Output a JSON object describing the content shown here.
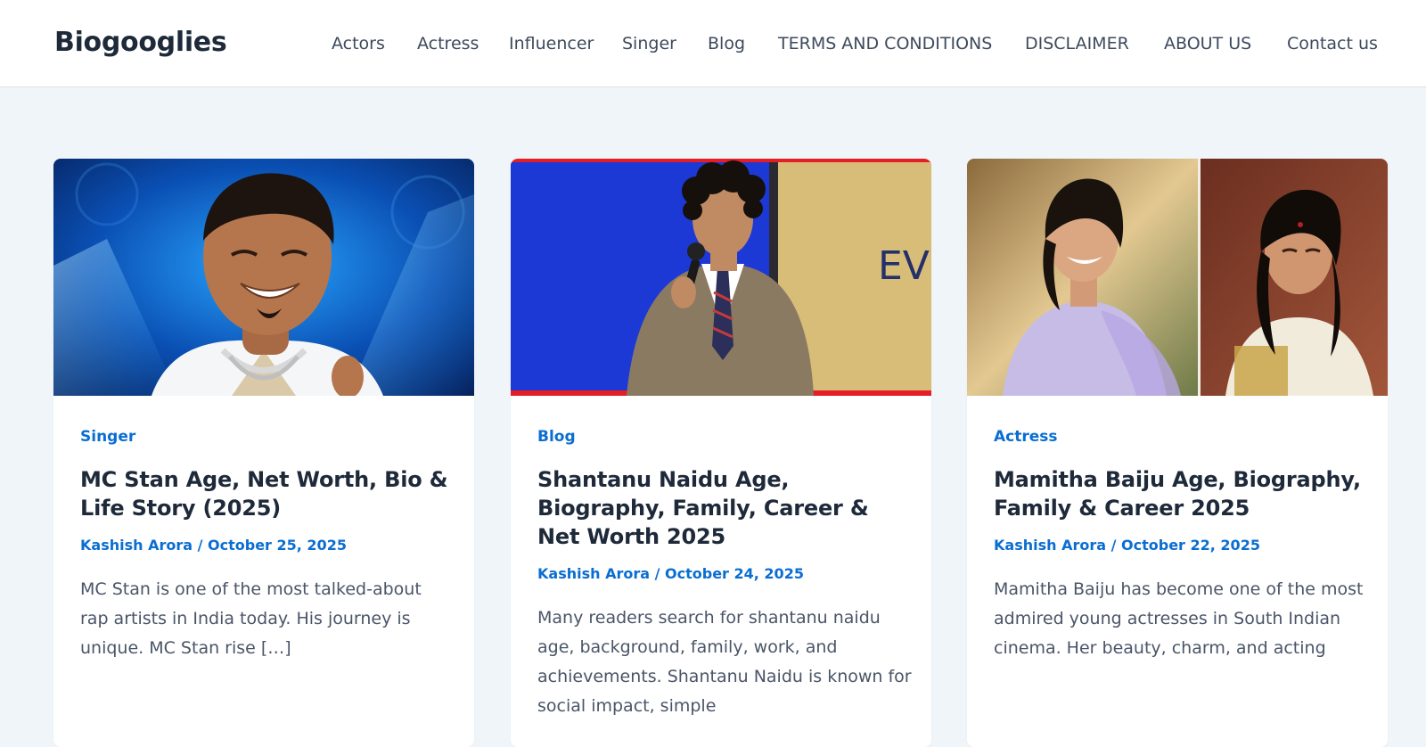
{
  "site": {
    "brand": "Biogooglies"
  },
  "nav": {
    "items": [
      {
        "label": "Actors"
      },
      {
        "label": "Actress"
      },
      {
        "label": "Influencer"
      },
      {
        "label": "Singer"
      },
      {
        "label": "Blog"
      },
      {
        "label": "TERMS AND CONDITIONS"
      },
      {
        "label": "DISCLAIMER"
      },
      {
        "label": "ABOUT US"
      },
      {
        "label": "Contact us"
      }
    ]
  },
  "posts": [
    {
      "category": "Singer",
      "title": "MC Stan Age, Net Worth, Bio & Life Story (2025)",
      "author": "Kashish Arora",
      "separator": " / ",
      "date": "October 25, 2025",
      "excerpt": "MC Stan is one of the most talked-about rap artists in India today. His journey is unique. MC Stan rise […]"
    },
    {
      "category": "Blog",
      "title": "Shantanu Naidu Age, Biography, Family, Career & Net Worth 2025",
      "author": "Kashish Arora",
      "separator": " / ",
      "date": "October 24, 2025",
      "excerpt": "Many readers search for shantanu naidu age, background, family, work, and achievements. Shantanu Naidu is known for social impact, simple",
      "image_text": "EV"
    },
    {
      "category": "Actress",
      "title": "Mamitha Baiju Age, Biography, Family & Career 2025",
      "author": "Kashish Arora",
      "separator": " / ",
      "date": "October 22, 2025",
      "excerpt": "Mamitha Baiju has become one of the most admired young actresses in South Indian cinema. Her beauty, charm, and acting"
    }
  ],
  "colors": {
    "accent": "#0a6ed1",
    "heading": "#1e2a3a",
    "page_bg": "#f0f5fa"
  }
}
